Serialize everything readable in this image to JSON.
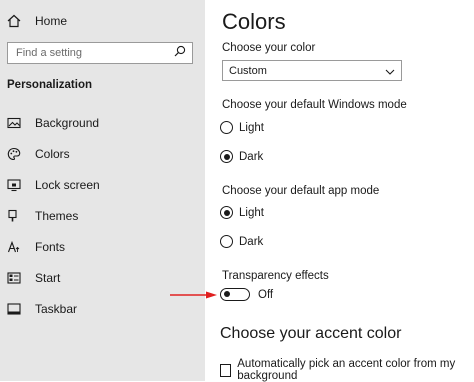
{
  "sidebar": {
    "home_label": "Home",
    "search_placeholder": "Find a setting",
    "section_title": "Personalization",
    "items": [
      {
        "label": "Background",
        "icon": "picture-icon"
      },
      {
        "label": "Colors",
        "icon": "palette-icon"
      },
      {
        "label": "Lock screen",
        "icon": "lock-screen-icon"
      },
      {
        "label": "Themes",
        "icon": "brush-icon"
      },
      {
        "label": "Fonts",
        "icon": "font-icon"
      },
      {
        "label": "Start",
        "icon": "start-icon"
      },
      {
        "label": "Taskbar",
        "icon": "taskbar-icon"
      }
    ]
  },
  "main": {
    "title": "Colors",
    "choose_color_label": "Choose your color",
    "choose_color_value": "Custom",
    "windows_mode_label": "Choose your default Windows mode",
    "windows_mode_options": [
      "Light",
      "Dark"
    ],
    "windows_mode_selected": "Dark",
    "app_mode_label": "Choose your default app mode",
    "app_mode_options": [
      "Light",
      "Dark"
    ],
    "app_mode_selected": "Light",
    "transparency_label": "Transparency effects",
    "transparency_state": "Off",
    "accent_heading": "Choose your accent color",
    "auto_accent_label": "Automatically pick an accent color from my background"
  },
  "colors": {
    "sidebar_bg": "#e6e6e6",
    "annotation_arrow": "#e02020"
  }
}
